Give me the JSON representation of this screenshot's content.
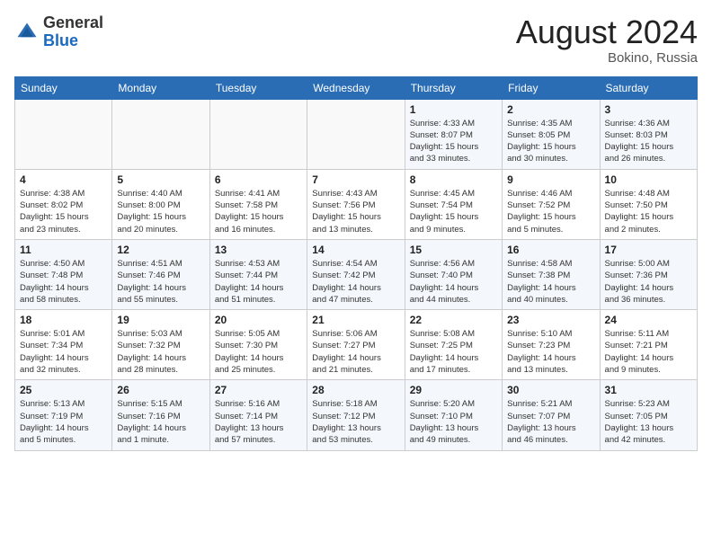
{
  "header": {
    "logo_line1": "General",
    "logo_line2": "Blue",
    "month_year": "August 2024",
    "location": "Bokino, Russia"
  },
  "weekdays": [
    "Sunday",
    "Monday",
    "Tuesday",
    "Wednesday",
    "Thursday",
    "Friday",
    "Saturday"
  ],
  "weeks": [
    [
      {
        "day": "",
        "detail": ""
      },
      {
        "day": "",
        "detail": ""
      },
      {
        "day": "",
        "detail": ""
      },
      {
        "day": "",
        "detail": ""
      },
      {
        "day": "1",
        "detail": "Sunrise: 4:33 AM\nSunset: 8:07 PM\nDaylight: 15 hours\nand 33 minutes."
      },
      {
        "day": "2",
        "detail": "Sunrise: 4:35 AM\nSunset: 8:05 PM\nDaylight: 15 hours\nand 30 minutes."
      },
      {
        "day": "3",
        "detail": "Sunrise: 4:36 AM\nSunset: 8:03 PM\nDaylight: 15 hours\nand 26 minutes."
      }
    ],
    [
      {
        "day": "4",
        "detail": "Sunrise: 4:38 AM\nSunset: 8:02 PM\nDaylight: 15 hours\nand 23 minutes."
      },
      {
        "day": "5",
        "detail": "Sunrise: 4:40 AM\nSunset: 8:00 PM\nDaylight: 15 hours\nand 20 minutes."
      },
      {
        "day": "6",
        "detail": "Sunrise: 4:41 AM\nSunset: 7:58 PM\nDaylight: 15 hours\nand 16 minutes."
      },
      {
        "day": "7",
        "detail": "Sunrise: 4:43 AM\nSunset: 7:56 PM\nDaylight: 15 hours\nand 13 minutes."
      },
      {
        "day": "8",
        "detail": "Sunrise: 4:45 AM\nSunset: 7:54 PM\nDaylight: 15 hours\nand 9 minutes."
      },
      {
        "day": "9",
        "detail": "Sunrise: 4:46 AM\nSunset: 7:52 PM\nDaylight: 15 hours\nand 5 minutes."
      },
      {
        "day": "10",
        "detail": "Sunrise: 4:48 AM\nSunset: 7:50 PM\nDaylight: 15 hours\nand 2 minutes."
      }
    ],
    [
      {
        "day": "11",
        "detail": "Sunrise: 4:50 AM\nSunset: 7:48 PM\nDaylight: 14 hours\nand 58 minutes."
      },
      {
        "day": "12",
        "detail": "Sunrise: 4:51 AM\nSunset: 7:46 PM\nDaylight: 14 hours\nand 55 minutes."
      },
      {
        "day": "13",
        "detail": "Sunrise: 4:53 AM\nSunset: 7:44 PM\nDaylight: 14 hours\nand 51 minutes."
      },
      {
        "day": "14",
        "detail": "Sunrise: 4:54 AM\nSunset: 7:42 PM\nDaylight: 14 hours\nand 47 minutes."
      },
      {
        "day": "15",
        "detail": "Sunrise: 4:56 AM\nSunset: 7:40 PM\nDaylight: 14 hours\nand 44 minutes."
      },
      {
        "day": "16",
        "detail": "Sunrise: 4:58 AM\nSunset: 7:38 PM\nDaylight: 14 hours\nand 40 minutes."
      },
      {
        "day": "17",
        "detail": "Sunrise: 5:00 AM\nSunset: 7:36 PM\nDaylight: 14 hours\nand 36 minutes."
      }
    ],
    [
      {
        "day": "18",
        "detail": "Sunrise: 5:01 AM\nSunset: 7:34 PM\nDaylight: 14 hours\nand 32 minutes."
      },
      {
        "day": "19",
        "detail": "Sunrise: 5:03 AM\nSunset: 7:32 PM\nDaylight: 14 hours\nand 28 minutes."
      },
      {
        "day": "20",
        "detail": "Sunrise: 5:05 AM\nSunset: 7:30 PM\nDaylight: 14 hours\nand 25 minutes."
      },
      {
        "day": "21",
        "detail": "Sunrise: 5:06 AM\nSunset: 7:27 PM\nDaylight: 14 hours\nand 21 minutes."
      },
      {
        "day": "22",
        "detail": "Sunrise: 5:08 AM\nSunset: 7:25 PM\nDaylight: 14 hours\nand 17 minutes."
      },
      {
        "day": "23",
        "detail": "Sunrise: 5:10 AM\nSunset: 7:23 PM\nDaylight: 14 hours\nand 13 minutes."
      },
      {
        "day": "24",
        "detail": "Sunrise: 5:11 AM\nSunset: 7:21 PM\nDaylight: 14 hours\nand 9 minutes."
      }
    ],
    [
      {
        "day": "25",
        "detail": "Sunrise: 5:13 AM\nSunset: 7:19 PM\nDaylight: 14 hours\nand 5 minutes."
      },
      {
        "day": "26",
        "detail": "Sunrise: 5:15 AM\nSunset: 7:16 PM\nDaylight: 14 hours\nand 1 minute."
      },
      {
        "day": "27",
        "detail": "Sunrise: 5:16 AM\nSunset: 7:14 PM\nDaylight: 13 hours\nand 57 minutes."
      },
      {
        "day": "28",
        "detail": "Sunrise: 5:18 AM\nSunset: 7:12 PM\nDaylight: 13 hours\nand 53 minutes."
      },
      {
        "day": "29",
        "detail": "Sunrise: 5:20 AM\nSunset: 7:10 PM\nDaylight: 13 hours\nand 49 minutes."
      },
      {
        "day": "30",
        "detail": "Sunrise: 5:21 AM\nSunset: 7:07 PM\nDaylight: 13 hours\nand 46 minutes."
      },
      {
        "day": "31",
        "detail": "Sunrise: 5:23 AM\nSunset: 7:05 PM\nDaylight: 13 hours\nand 42 minutes."
      }
    ]
  ]
}
